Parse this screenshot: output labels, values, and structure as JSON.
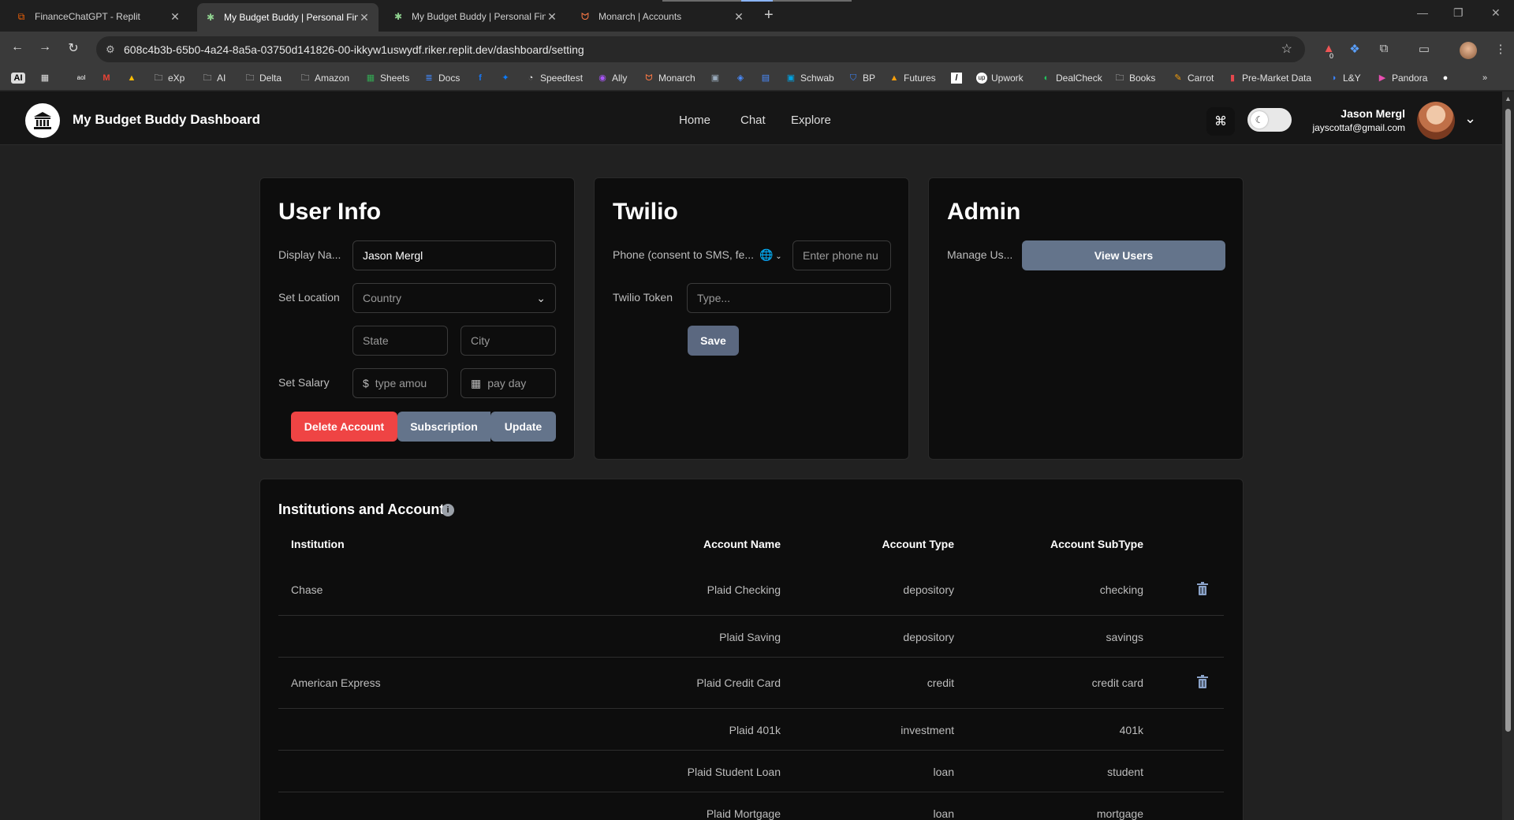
{
  "browser": {
    "tabs": [
      {
        "title": "FinanceChatGPT - Replit",
        "icon": "replit-icon"
      },
      {
        "title": "My Budget Buddy | Personal Fin",
        "icon": "money-icon"
      },
      {
        "title": "My Budget Buddy | Personal Fin",
        "icon": "money-icon"
      },
      {
        "title": "Monarch | Accounts",
        "icon": "monarch-icon"
      }
    ],
    "url": "608c4b3b-65b0-4a24-8a5a-03750d141826-00-ikkyw1uswydf.riker.replit.dev/dashboard/setting",
    "extension_badge": "0",
    "bookmarks": [
      "AI",
      "eXp",
      "AI",
      "Delta",
      "Amazon",
      "Sheets",
      "Docs",
      "Speedtest",
      "Ally",
      "Monarch",
      "Schwab",
      "BP",
      "Futures",
      "Upwork",
      "DealCheck",
      "Books",
      "Carrot",
      "Pre-Market Data",
      "L&Y",
      "Pandora"
    ]
  },
  "app": {
    "brand": "My Budget Buddy Dashboard",
    "nav": {
      "home": "Home",
      "chat": "Chat",
      "explore": "Explore"
    },
    "user": {
      "name": "Jason Mergl",
      "email": "jayscottaf@gmail.com"
    }
  },
  "user_info": {
    "title": "User Info",
    "display_name_label": "Display Na...",
    "display_name_value": "Jason Mergl",
    "location_label": "Set Location",
    "country_placeholder": "Country",
    "state_placeholder": "State",
    "city_placeholder": "City",
    "salary_label": "Set Salary",
    "amount_placeholder": "type amou",
    "payday_placeholder": "pay day",
    "delete_label": "Delete Account",
    "subscription_label": "Subscription",
    "update_label": "Update"
  },
  "twilio": {
    "title": "Twilio",
    "phone_label": "Phone (consent to SMS, fe...",
    "phone_placeholder": "Enter phone nu",
    "token_label": "Twilio Token",
    "token_placeholder": "Type...",
    "save_label": "Save"
  },
  "admin": {
    "title": "Admin",
    "manage_label": "Manage Us...",
    "view_users_label": "View Users"
  },
  "accounts": {
    "title": "Institutions and Accounts",
    "columns": {
      "institution": "Institution",
      "name": "Account Name",
      "type": "Account Type",
      "subtype": "Account SubType"
    },
    "rows": [
      {
        "institution": "Chase",
        "name": "Plaid Checking",
        "type": "depository",
        "subtype": "checking"
      },
      {
        "institution": "",
        "name": "Plaid Saving",
        "type": "depository",
        "subtype": "savings"
      },
      {
        "institution": "American Express",
        "name": "Plaid Credit Card",
        "type": "credit",
        "subtype": "credit card"
      },
      {
        "institution": "",
        "name": "Plaid 401k",
        "type": "investment",
        "subtype": "401k"
      },
      {
        "institution": "",
        "name": "Plaid Student Loan",
        "type": "loan",
        "subtype": "student"
      },
      {
        "institution": "",
        "name": "Plaid Mortgage",
        "type": "loan",
        "subtype": "mortgage"
      }
    ]
  }
}
